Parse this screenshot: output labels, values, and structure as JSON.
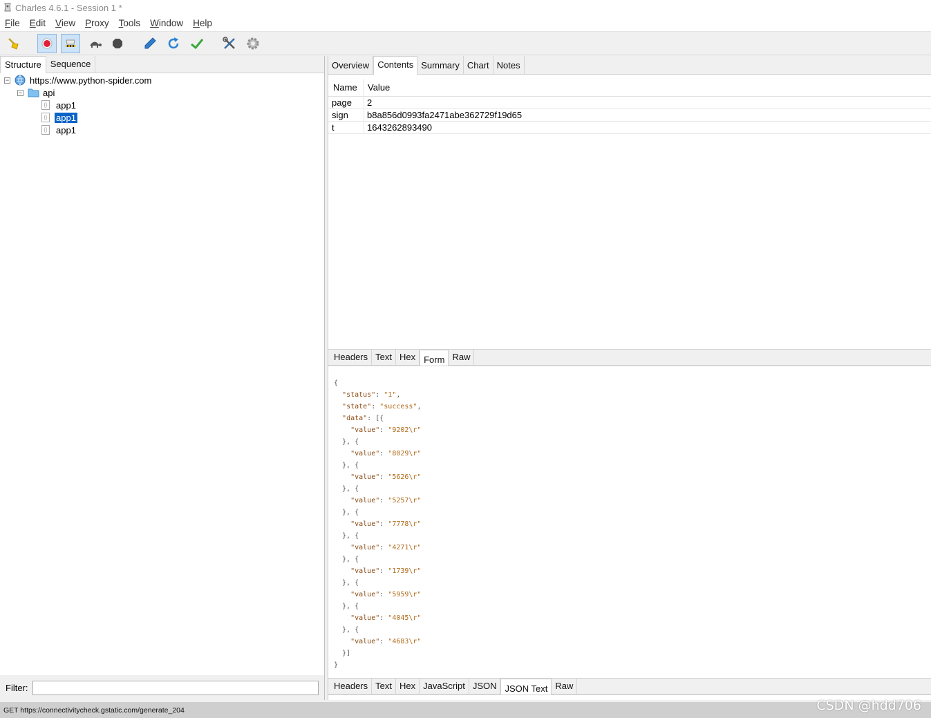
{
  "window": {
    "title": "Charles 4.6.1 - Session 1 *"
  },
  "menu": [
    {
      "first": "F",
      "rest": "ile"
    },
    {
      "first": "E",
      "rest": "dit"
    },
    {
      "first": "V",
      "rest": "iew"
    },
    {
      "first": "P",
      "rest": "roxy"
    },
    {
      "first": "T",
      "rest": "ools"
    },
    {
      "first": "W",
      "rest": "indow"
    },
    {
      "first": "H",
      "rest": "elp"
    }
  ],
  "toolbar": {
    "icons": [
      "broom-icon",
      "record-icon",
      "throttle-icon",
      "breakpoint-turtle-icon",
      "stop-icon",
      "compose-pen-icon",
      "repeat-icon",
      "validate-check-icon",
      "tools-icon",
      "settings-gear-icon"
    ]
  },
  "left": {
    "tabs": [
      "Structure",
      "Sequence"
    ],
    "tree": {
      "host": "https://www.python-spider.com",
      "folder": "api",
      "items": [
        "app1",
        "app1",
        "app1"
      ]
    },
    "filter_label": "Filter:",
    "filter_value": ""
  },
  "right": {
    "tabs": [
      "Overview",
      "Contents",
      "Summary",
      "Chart",
      "Notes"
    ],
    "form": {
      "headers": [
        "Name",
        "Value"
      ],
      "rows": [
        {
          "name": "page",
          "value": "2"
        },
        {
          "name": "sign",
          "value": "b8a856d0993fa2471abe362729f19d65"
        },
        {
          "name": "t",
          "value": "1643262893490"
        }
      ]
    },
    "request_tabs": [
      "Headers",
      "Text",
      "Hex",
      "Form",
      "Raw"
    ],
    "response_tabs": [
      "Headers",
      "Text",
      "Hex",
      "JavaScript",
      "JSON",
      "JSON Text",
      "Raw"
    ],
    "json": {
      "status": "1",
      "state": "success",
      "values": [
        "9202\\r",
        "8029\\r",
        "5626\\r",
        "5257\\r",
        "7778\\r",
        "4271\\r",
        "1739\\r",
        "5959\\r",
        "4045\\r",
        "4683\\r"
      ]
    }
  },
  "status": {
    "text": "GET https://connectivitycheck.gstatic.com/generate_204"
  },
  "watermark": "CSDN @hdd706"
}
